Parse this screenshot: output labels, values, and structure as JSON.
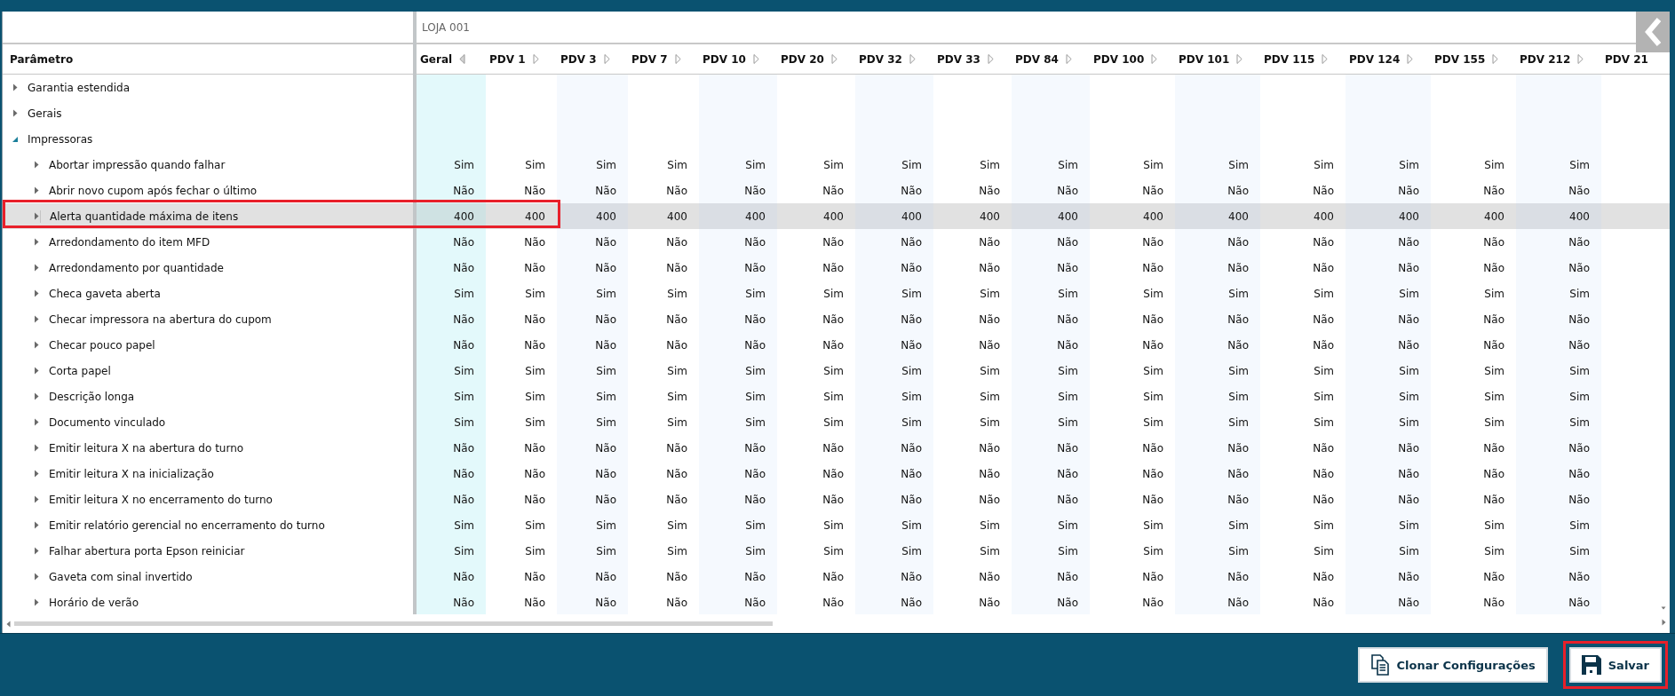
{
  "store_label": "LOJA 001",
  "parameter_header": "Parâmetro",
  "columns": [
    {
      "label": "Geral",
      "expanded": true
    },
    {
      "label": "PDV 1",
      "expanded": false
    },
    {
      "label": "PDV 3",
      "expanded": false
    },
    {
      "label": "PDV 7",
      "expanded": false
    },
    {
      "label": "PDV 10",
      "expanded": false
    },
    {
      "label": "PDV 20",
      "expanded": false
    },
    {
      "label": "PDV 32",
      "expanded": false
    },
    {
      "label": "PDV 33",
      "expanded": false
    },
    {
      "label": "PDV 84",
      "expanded": false
    },
    {
      "label": "PDV 100",
      "expanded": false
    },
    {
      "label": "PDV 101",
      "expanded": false
    },
    {
      "label": "PDV 115",
      "expanded": false
    },
    {
      "label": "PDV 124",
      "expanded": false
    },
    {
      "label": "PDV 155",
      "expanded": false
    },
    {
      "label": "PDV 212",
      "expanded": false
    },
    {
      "label": "PDV 21"
    }
  ],
  "parameters": [
    {
      "label": "Garantia estendida",
      "expanded": false,
      "selected": false
    },
    {
      "label": "Gerais",
      "expanded": false,
      "selected": false
    },
    {
      "label": "Impressoras",
      "expanded": true,
      "selected": false,
      "children": [
        {
          "label": "Abortar impressão quando falhar",
          "expanded": false,
          "selected": false,
          "highlighted": false,
          "values": [
            "Sim",
            "Sim",
            "Sim",
            "Sim",
            "Sim",
            "Sim",
            "Sim",
            "Sim",
            "Sim",
            "Sim",
            "Sim",
            "Sim",
            "Sim",
            "Sim",
            "Sim"
          ]
        },
        {
          "label": "Abrir novo cupom após fechar o último",
          "expanded": false,
          "selected": false,
          "highlighted": false,
          "values": [
            "Não",
            "Não",
            "Não",
            "Não",
            "Não",
            "Não",
            "Não",
            "Não",
            "Não",
            "Não",
            "Não",
            "Não",
            "Não",
            "Não",
            "Não"
          ]
        },
        {
          "label": "Alerta quantidade máxima de itens",
          "expanded": false,
          "selected": true,
          "highlighted": true,
          "values": [
            "400",
            "400",
            "400",
            "400",
            "400",
            "400",
            "400",
            "400",
            "400",
            "400",
            "400",
            "400",
            "400",
            "400",
            "400"
          ]
        },
        {
          "label": "Arredondamento do item MFD",
          "expanded": false,
          "selected": false,
          "highlighted": false,
          "values": [
            "Não",
            "Não",
            "Não",
            "Não",
            "Não",
            "Não",
            "Não",
            "Não",
            "Não",
            "Não",
            "Não",
            "Não",
            "Não",
            "Não",
            "Não"
          ]
        },
        {
          "label": "Arredondamento por quantidade",
          "expanded": false,
          "selected": false,
          "highlighted": false,
          "values": [
            "Não",
            "Não",
            "Não",
            "Não",
            "Não",
            "Não",
            "Não",
            "Não",
            "Não",
            "Não",
            "Não",
            "Não",
            "Não",
            "Não",
            "Não"
          ]
        },
        {
          "label": "Checa gaveta aberta",
          "expanded": false,
          "selected": false,
          "highlighted": false,
          "values": [
            "Sim",
            "Sim",
            "Sim",
            "Sim",
            "Sim",
            "Sim",
            "Sim",
            "Sim",
            "Sim",
            "Sim",
            "Sim",
            "Sim",
            "Sim",
            "Sim",
            "Sim"
          ]
        },
        {
          "label": "Checar impressora na abertura do cupom",
          "expanded": false,
          "selected": false,
          "highlighted": false,
          "values": [
            "Não",
            "Não",
            "Não",
            "Não",
            "Não",
            "Não",
            "Não",
            "Não",
            "Não",
            "Não",
            "Não",
            "Não",
            "Não",
            "Não",
            "Não"
          ]
        },
        {
          "label": "Checar pouco papel",
          "expanded": false,
          "selected": false,
          "highlighted": false,
          "values": [
            "Não",
            "Não",
            "Não",
            "Não",
            "Não",
            "Não",
            "Não",
            "Não",
            "Não",
            "Não",
            "Não",
            "Não",
            "Não",
            "Não",
            "Não"
          ]
        },
        {
          "label": "Corta papel",
          "expanded": false,
          "selected": false,
          "highlighted": false,
          "values": [
            "Sim",
            "Sim",
            "Sim",
            "Sim",
            "Sim",
            "Sim",
            "Sim",
            "Sim",
            "Sim",
            "Sim",
            "Sim",
            "Sim",
            "Sim",
            "Sim",
            "Sim"
          ]
        },
        {
          "label": "Descrição longa",
          "expanded": false,
          "selected": false,
          "highlighted": false,
          "values": [
            "Sim",
            "Sim",
            "Sim",
            "Sim",
            "Sim",
            "Sim",
            "Sim",
            "Sim",
            "Sim",
            "Sim",
            "Sim",
            "Sim",
            "Sim",
            "Sim",
            "Sim"
          ]
        },
        {
          "label": "Documento vinculado",
          "expanded": false,
          "selected": false,
          "highlighted": false,
          "values": [
            "Sim",
            "Sim",
            "Sim",
            "Sim",
            "Sim",
            "Sim",
            "Sim",
            "Sim",
            "Sim",
            "Sim",
            "Sim",
            "Sim",
            "Sim",
            "Sim",
            "Sim"
          ]
        },
        {
          "label": "Emitir leitura X na abertura do turno",
          "expanded": false,
          "selected": false,
          "highlighted": false,
          "values": [
            "Não",
            "Não",
            "Não",
            "Não",
            "Não",
            "Não",
            "Não",
            "Não",
            "Não",
            "Não",
            "Não",
            "Não",
            "Não",
            "Não",
            "Não"
          ]
        },
        {
          "label": "Emitir leitura X na inicialização",
          "expanded": false,
          "selected": false,
          "highlighted": false,
          "values": [
            "Não",
            "Não",
            "Não",
            "Não",
            "Não",
            "Não",
            "Não",
            "Não",
            "Não",
            "Não",
            "Não",
            "Não",
            "Não",
            "Não",
            "Não"
          ]
        },
        {
          "label": "Emitir leitura X no encerramento do turno",
          "expanded": false,
          "selected": false,
          "highlighted": false,
          "values": [
            "Não",
            "Não",
            "Não",
            "Não",
            "Não",
            "Não",
            "Não",
            "Não",
            "Não",
            "Não",
            "Não",
            "Não",
            "Não",
            "Não",
            "Não"
          ]
        },
        {
          "label": "Emitir relatório gerencial no encerramento do turno",
          "expanded": false,
          "selected": false,
          "highlighted": false,
          "values": [
            "Sim",
            "Sim",
            "Sim",
            "Sim",
            "Sim",
            "Sim",
            "Sim",
            "Sim",
            "Sim",
            "Sim",
            "Sim",
            "Sim",
            "Sim",
            "Sim",
            "Sim"
          ]
        },
        {
          "label": "Falhar abertura porta Epson reiniciar",
          "expanded": false,
          "selected": false,
          "highlighted": false,
          "values": [
            "Sim",
            "Sim",
            "Sim",
            "Sim",
            "Sim",
            "Sim",
            "Sim",
            "Sim",
            "Sim",
            "Sim",
            "Sim",
            "Sim",
            "Sim",
            "Sim",
            "Sim"
          ]
        },
        {
          "label": "Gaveta com sinal invertido",
          "expanded": false,
          "selected": false,
          "highlighted": false,
          "values": [
            "Não",
            "Não",
            "Não",
            "Não",
            "Não",
            "Não",
            "Não",
            "Não",
            "Não",
            "Não",
            "Não",
            "Não",
            "Não",
            "Não",
            "Não"
          ]
        },
        {
          "label": "Horário de verão",
          "expanded": false,
          "selected": false,
          "highlighted": false,
          "values": [
            "Não",
            "Não",
            "Não",
            "Não",
            "Não",
            "Não",
            "Não",
            "Não",
            "Não",
            "Não",
            "Não",
            "Não",
            "Não",
            "Não",
            "Não"
          ]
        }
      ]
    }
  ],
  "buttons": [
    {
      "kind": "clone",
      "label": "Clonar Configurações",
      "highlighted": false
    },
    {
      "kind": "save",
      "label": "Salvar",
      "highlighted": true
    }
  ]
}
